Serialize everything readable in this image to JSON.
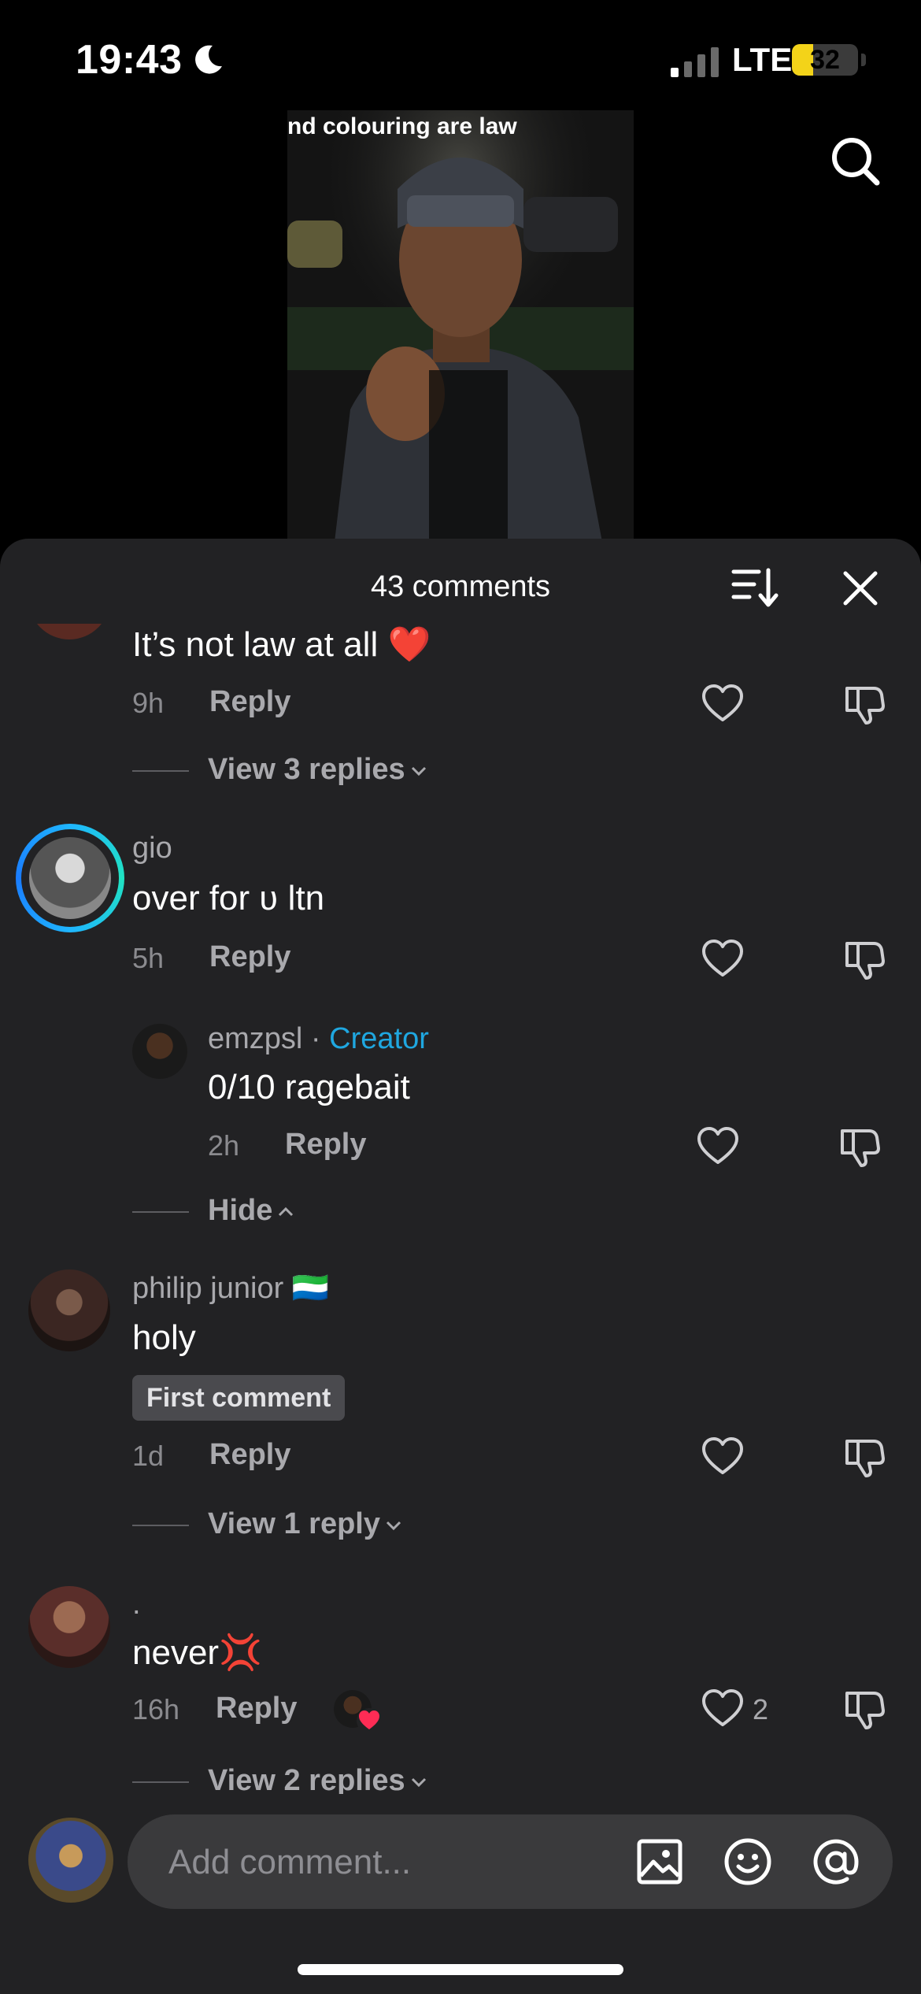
{
  "status_bar": {
    "time": "19:43",
    "network": "LTE",
    "battery": "32",
    "battery_level": 0.32,
    "colors": {
      "battery_fill": "#f3d319"
    }
  },
  "video": {
    "caption": "nd colouring are law"
  },
  "comments_sheet": {
    "title": "43 comments",
    "comments": [
      {
        "text": "It’s not law at all",
        "emoji": "❤️",
        "time": "9h",
        "reply_label": "Reply",
        "thread_label": "View 3 replies"
      },
      {
        "username": "gio",
        "text": "over for ʋ ltn",
        "time": "5h",
        "reply_label": "Reply",
        "replies": [
          {
            "username": "emzpsl",
            "separator": " · ",
            "role": "Creator",
            "text": "0/10 ragebait",
            "time": "2h",
            "reply_label": "Reply"
          }
        ],
        "thread_label": "Hide"
      },
      {
        "username": "philip junior",
        "flag": "🇸🇱",
        "text": "holy",
        "badge": "First comment",
        "time": "1d",
        "reply_label": "Reply",
        "thread_label": "View 1 reply"
      },
      {
        "username": ".",
        "text": "never",
        "emoji": "💢",
        "time": "16h",
        "reply_label": "Reply",
        "like_count": "2",
        "thread_label": "View 2 replies"
      }
    ]
  },
  "input": {
    "placeholder": "Add comment..."
  },
  "colors": {
    "sheet_bg": "#222224",
    "creator": "#1fa7e0",
    "avatar_ring": "#1fb6ff"
  }
}
